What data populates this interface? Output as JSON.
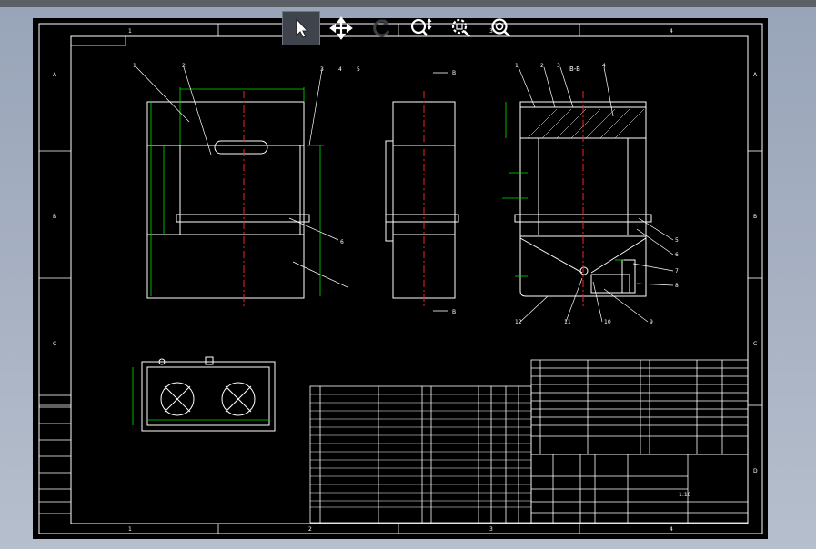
{
  "toolbar": {
    "tools": [
      {
        "name": "select-arrow-icon",
        "active": true
      },
      {
        "name": "pan-move-icon",
        "active": false
      },
      {
        "name": "rotate-icon",
        "active": false
      },
      {
        "name": "zoom-in-out-icon",
        "active": false
      },
      {
        "name": "zoom-window-icon",
        "active": false
      },
      {
        "name": "zoom-extents-icon",
        "active": false
      }
    ]
  },
  "drawing": {
    "border_cols_top": [
      "1",
      "2",
      "3",
      "4"
    ],
    "border_cols_bottom": [
      "1",
      "2",
      "3",
      "4"
    ],
    "border_rows_left": [
      "A",
      "B",
      "C",
      "D"
    ],
    "border_rows_right": [
      "A",
      "B",
      "C",
      "D"
    ],
    "section_label": "B-B",
    "section_mark": "B",
    "leaders_front": [
      "1",
      "2",
      "3",
      "4",
      "5",
      "6"
    ],
    "leaders_section": [
      "1",
      "2",
      "3",
      "4",
      "5",
      "6",
      "7",
      "8",
      "9",
      "10",
      "11",
      "12"
    ],
    "scale": "1:10"
  },
  "colors": {
    "canvas": "#000000",
    "line": "#ffffff",
    "dimension": "#00e000",
    "centerline": "#ff2020"
  }
}
